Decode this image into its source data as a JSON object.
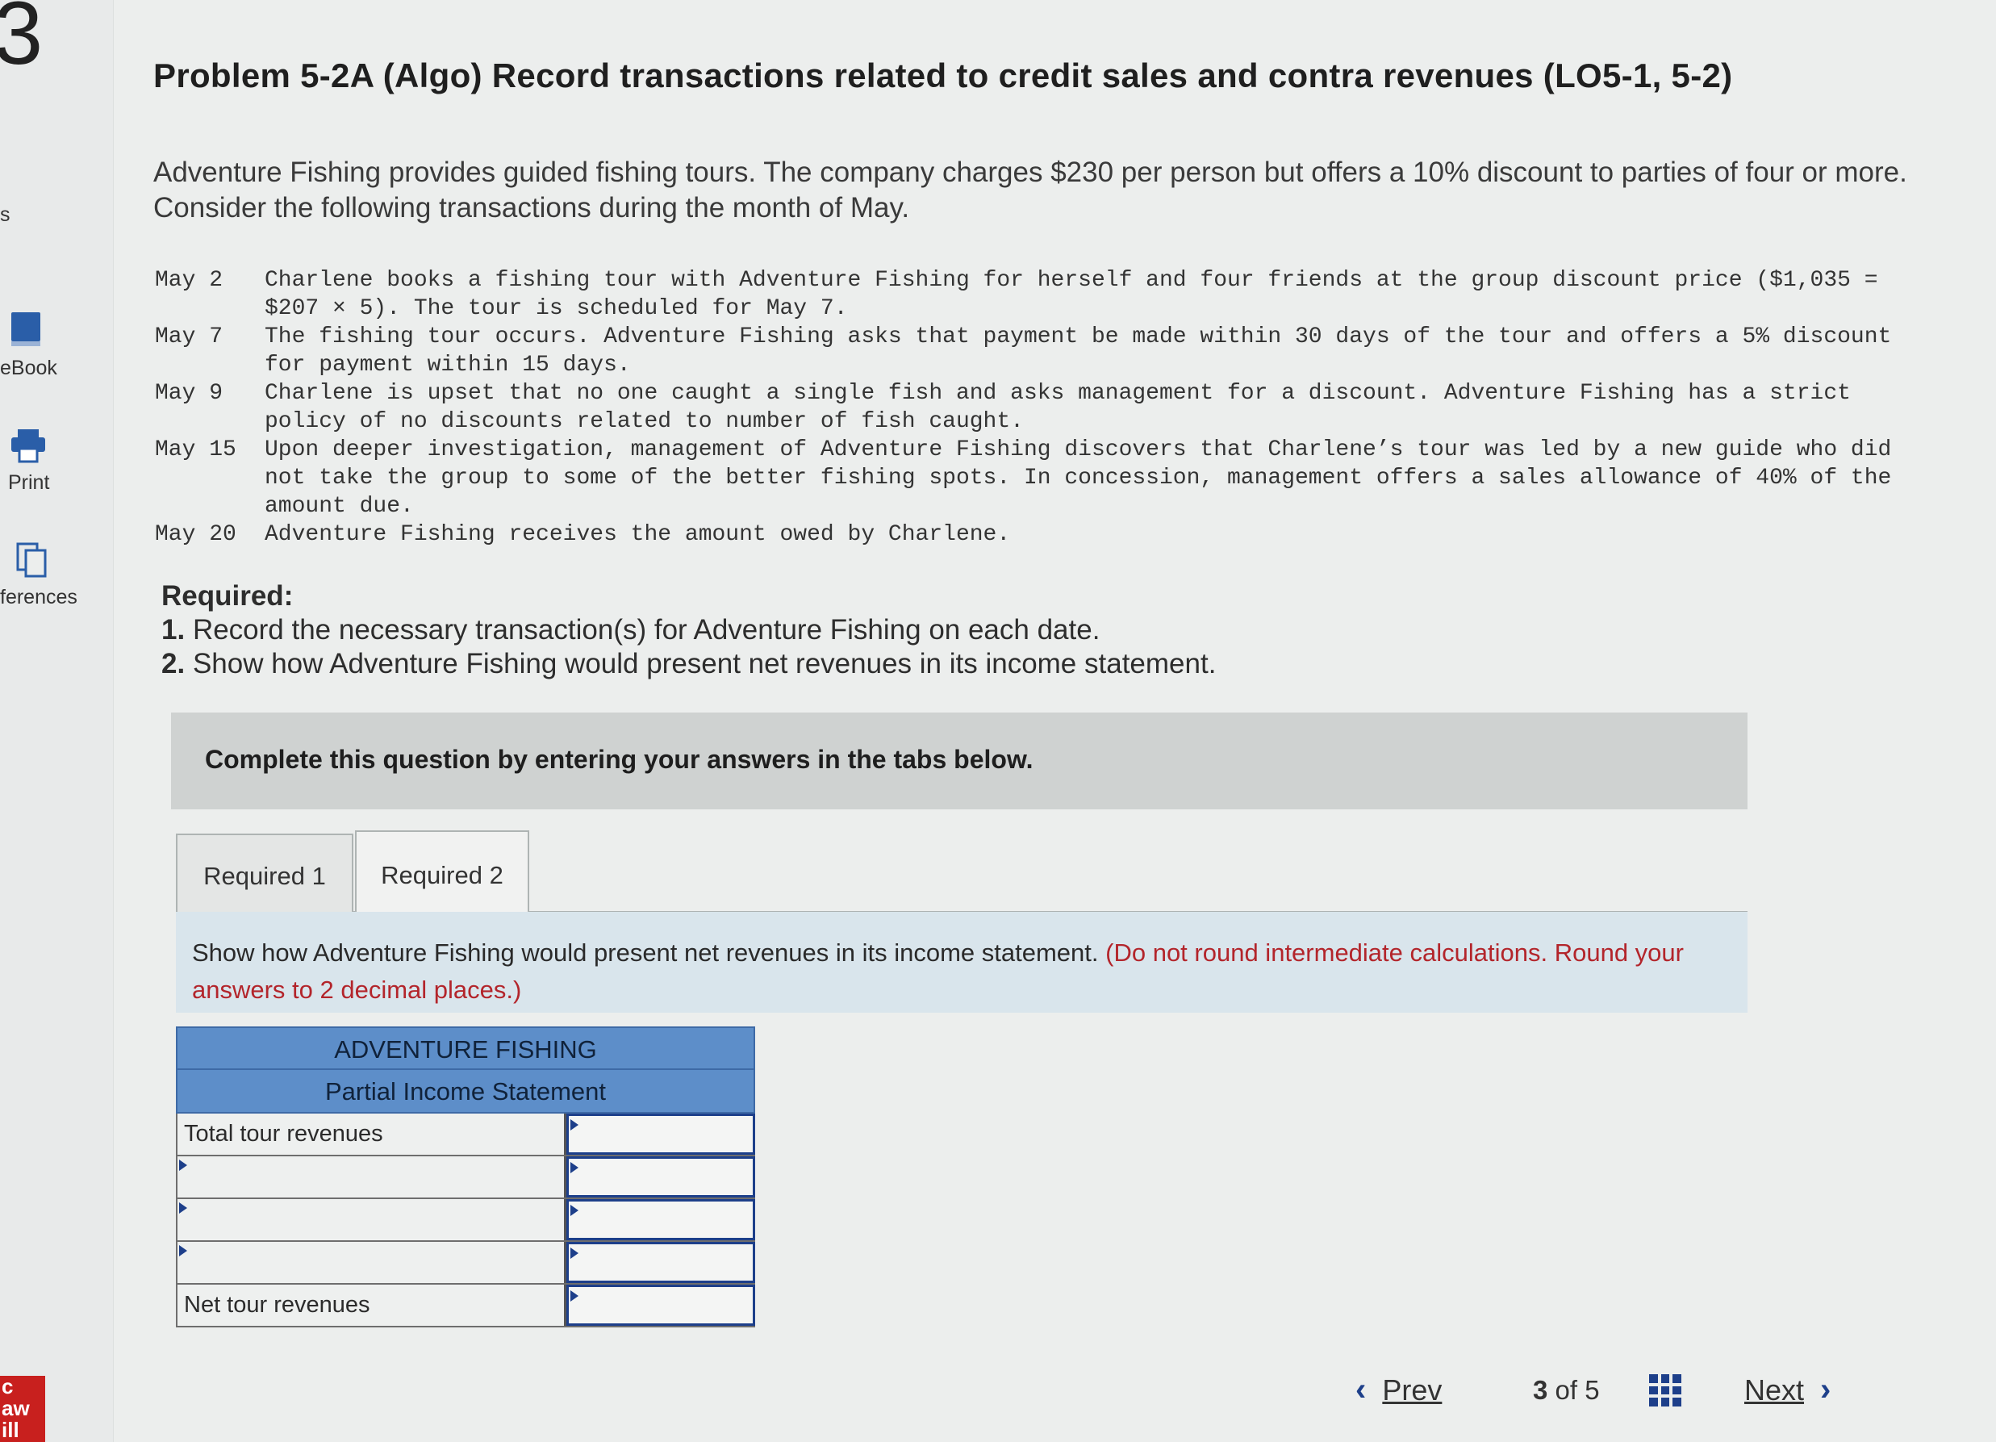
{
  "sidebar": {
    "step_number": "3",
    "items": [
      {
        "label": "s"
      },
      {
        "label": "eBook"
      },
      {
        "label": "Print"
      },
      {
        "label": "ferences"
      }
    ],
    "brand": "c\naw\nill"
  },
  "problem": {
    "title": "Problem 5-2A (Algo) Record transactions related to credit sales and contra revenues (LO5-1, 5-2)",
    "intro": "Adventure Fishing provides guided fishing tours. The company charges $230 per person but offers a 10% discount to parties of four or more. Consider the following transactions during the month of May.",
    "transactions": [
      {
        "date": "May 2",
        "text": "Charlene books a fishing tour with Adventure Fishing for herself and four friends at the group discount price ($1,035 = $207 × 5). The tour is scheduled for May 7."
      },
      {
        "date": "May 7",
        "text": "The fishing tour occurs. Adventure Fishing asks that payment be made within 30 days of the tour and offers a 5% discount for payment within 15 days."
      },
      {
        "date": "May 9",
        "text": "Charlene is upset that no one caught a single fish and asks management for a discount. Adventure Fishing has a strict policy of no discounts related to number of fish caught."
      },
      {
        "date": "May 15",
        "text": "Upon deeper investigation, management of Adventure Fishing discovers that Charlene’s tour was led by a new guide who did not take the group to some of the better fishing spots. In concession, management offers a sales allowance of 40% of the amount due."
      },
      {
        "date": "May 20",
        "text": "Adventure Fishing receives the amount owed by Charlene."
      }
    ],
    "required_heading": "Required:",
    "required_items": [
      {
        "num": "1.",
        "text": "Record the necessary transaction(s) for Adventure Fishing on each date."
      },
      {
        "num": "2.",
        "text": "Show how Adventure Fishing would present net revenues in its income statement."
      }
    ]
  },
  "instruction": "Complete this question by entering your answers in the tabs below.",
  "tabs": [
    {
      "label": "Required 1"
    },
    {
      "label": "Required 2"
    }
  ],
  "prompt": {
    "text": "Show how Adventure Fishing would present net revenues in its income statement.",
    "note": "(Do not round intermediate calculations. Round your answers to 2 decimal places.)"
  },
  "statement": {
    "company": "ADVENTURE FISHING",
    "subtitle": "Partial Income Statement",
    "rows": [
      {
        "label": "Total tour revenues",
        "value": ""
      },
      {
        "label": "",
        "value": ""
      },
      {
        "label": "",
        "value": ""
      },
      {
        "label": "",
        "value": ""
      },
      {
        "label": "Net tour revenues",
        "value": ""
      }
    ]
  },
  "pager": {
    "prev": "Prev",
    "current": "3",
    "of": "of",
    "total": "5",
    "next": "Next"
  },
  "colors": {
    "table_header": "#5d8ec9",
    "prompt_bg": "#d9e5ec",
    "accent": "#1d3f8a",
    "note_red": "#b3252b"
  }
}
